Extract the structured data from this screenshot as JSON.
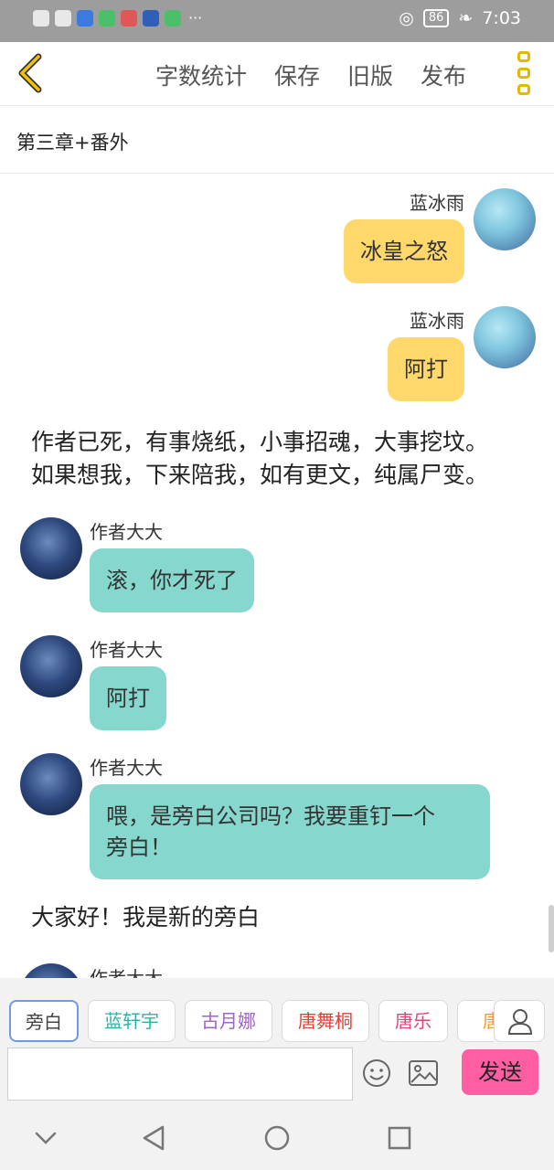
{
  "status_bar": {
    "battery": "86",
    "time": "7:03"
  },
  "toolbar": {
    "word_count": "字数统计",
    "save": "保存",
    "old_version": "旧版",
    "publish": "发布"
  },
  "chapter_title": "第三章+番外",
  "messages": [
    {
      "name": "蓝冰雨",
      "text": "冰皇之怒"
    },
    {
      "name": "蓝冰雨",
      "text": "阿打"
    },
    {
      "narration_line1": "作者已死，有事烧纸，小事招魂，大事挖坟。",
      "narration_line2": "如果想我，下来陪我，如有更文，纯属尸变。"
    },
    {
      "name": "作者大大",
      "text": "滚，你才死了"
    },
    {
      "name": "作者大大",
      "text": "阿打"
    },
    {
      "name": "作者大大",
      "text_line1": "喂，是旁白公司吗？我要重钉一个",
      "text_line2": "旁白！"
    },
    {
      "narration": "大家好！我是新的旁白"
    },
    {
      "name": "作者大大"
    }
  ],
  "characters": [
    {
      "label": "旁白",
      "color": "#444444"
    },
    {
      "label": "蓝轩宇",
      "color": "#2bb3a6"
    },
    {
      "label": "古月娜",
      "color": "#a262c8"
    },
    {
      "label": "唐舞桐",
      "color": "#d9433b"
    },
    {
      "label": "唐乐",
      "color": "#e0457a"
    },
    {
      "label": "唐",
      "color": "#f0a020"
    }
  ],
  "input": {
    "placeholder": ""
  },
  "send_label": "发送",
  "icons": [
    "back-icon",
    "more-icon",
    "user-icon",
    "emoji-icon",
    "image-icon",
    "nav-down-icon",
    "nav-back-icon",
    "nav-home-icon",
    "nav-recent-icon"
  ]
}
